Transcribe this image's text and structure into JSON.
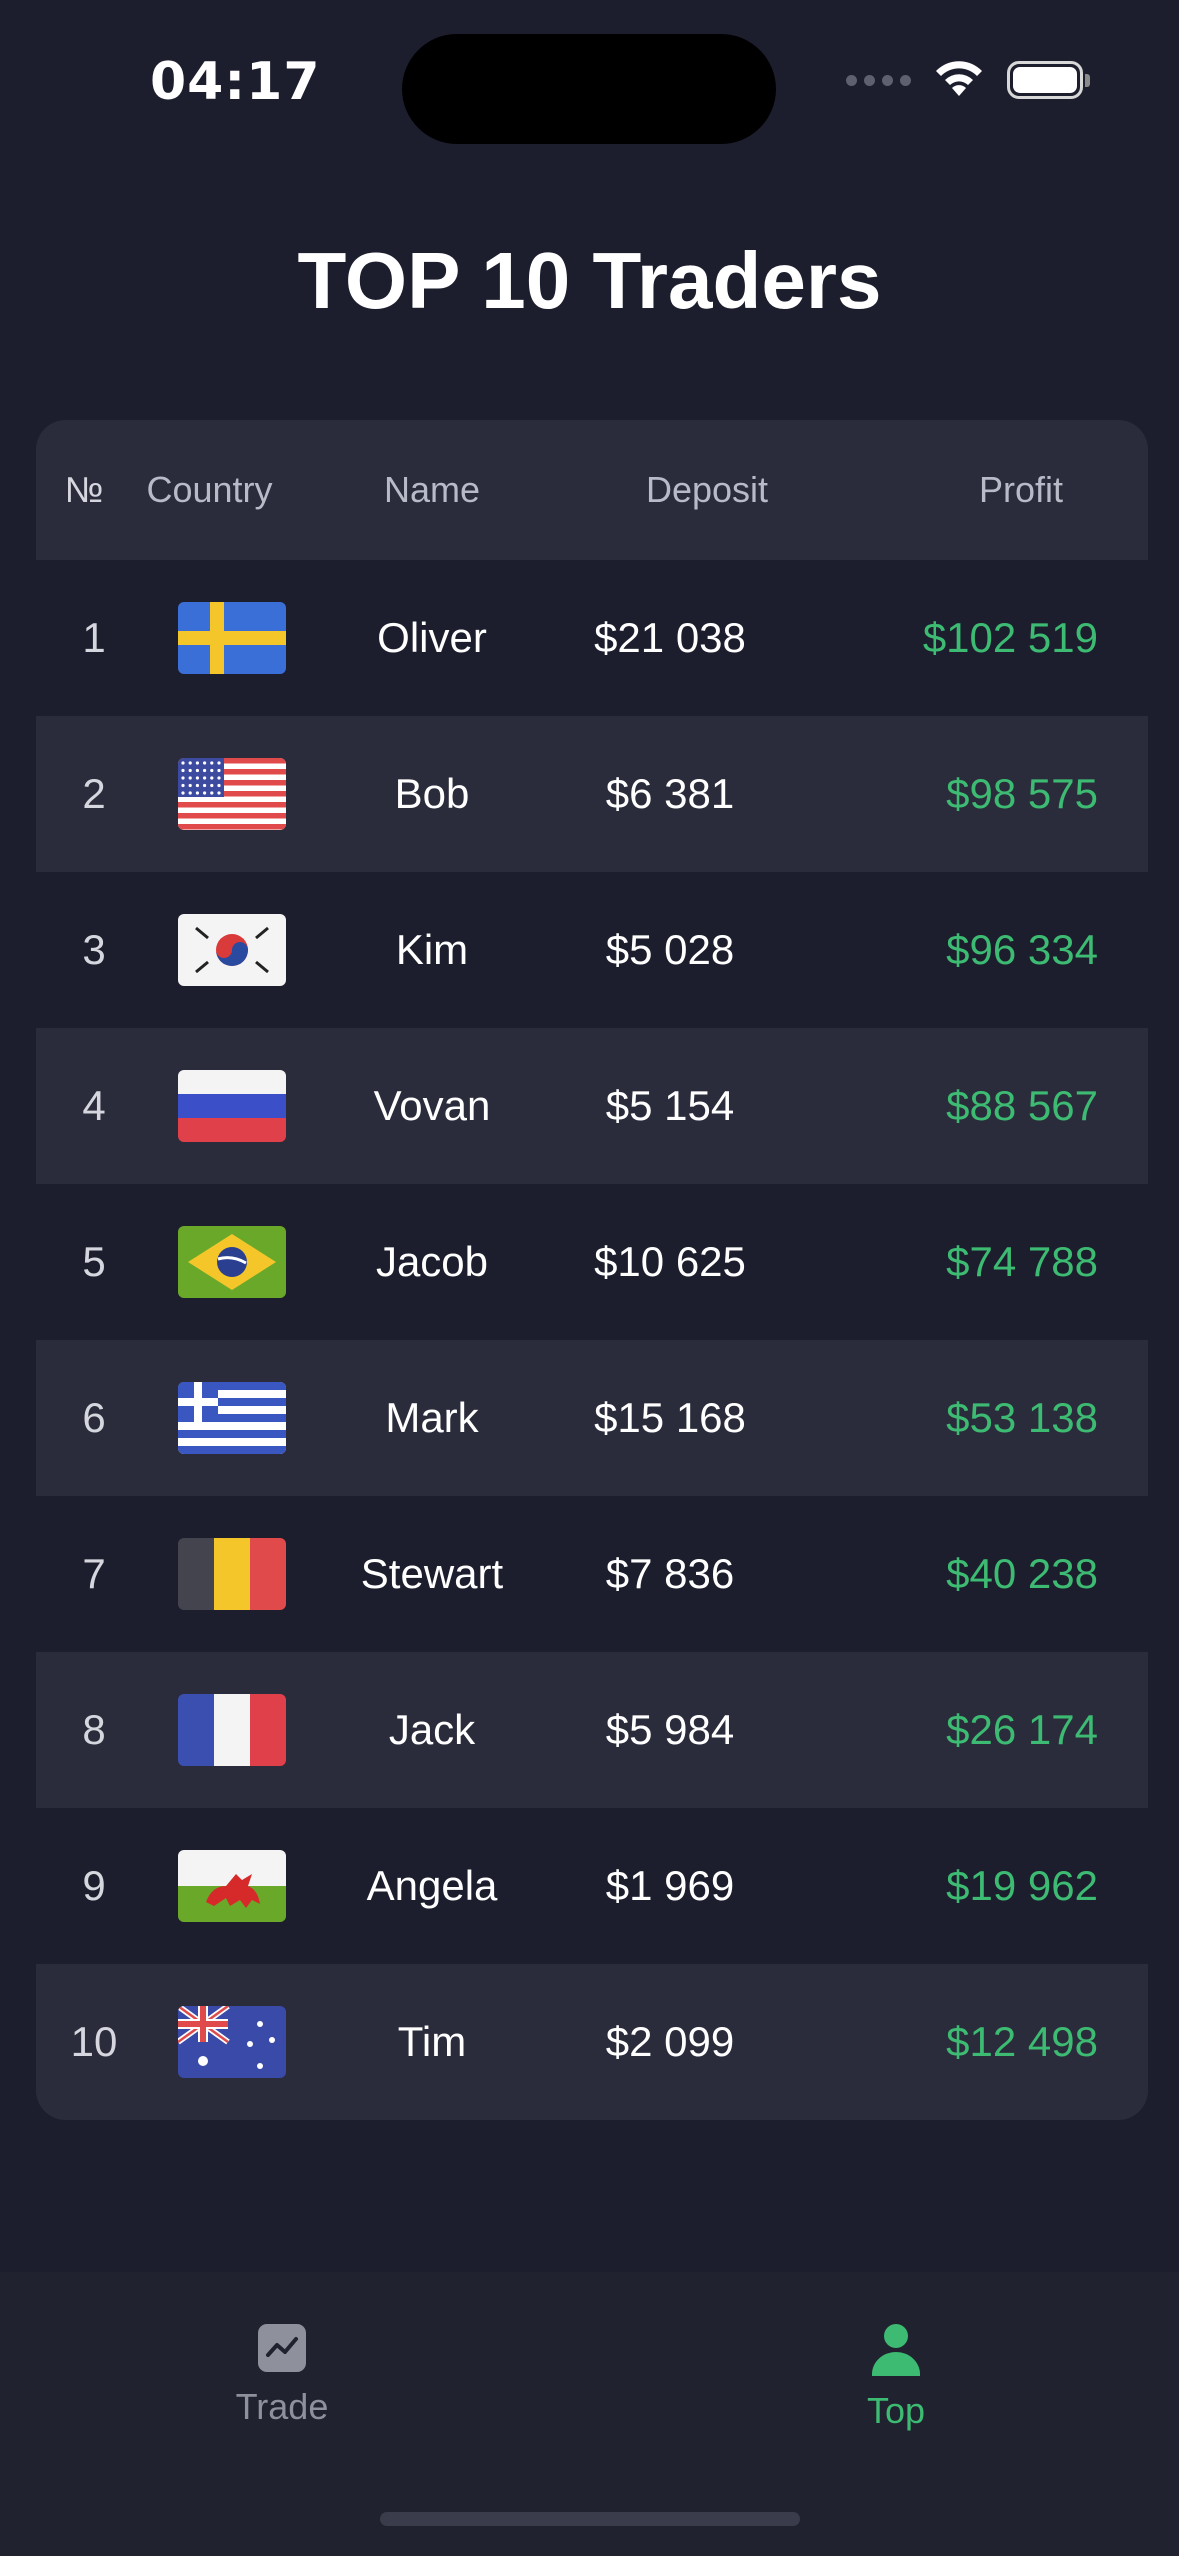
{
  "status_bar": {
    "time": "04:17"
  },
  "title": "TOP 10 Traders",
  "table": {
    "headers": {
      "num": "№",
      "country": "Country",
      "name": "Name",
      "deposit": "Deposit",
      "profit": "Profit"
    },
    "rows": [
      {
        "num": "1",
        "flag": "sweden",
        "name": "Oliver",
        "deposit": "$21 038",
        "profit": "$102 519"
      },
      {
        "num": "2",
        "flag": "usa",
        "name": "Bob",
        "deposit": "$6 381",
        "profit": "$98 575"
      },
      {
        "num": "3",
        "flag": "south-korea",
        "name": "Kim",
        "deposit": "$5 028",
        "profit": "$96 334"
      },
      {
        "num": "4",
        "flag": "russia",
        "name": "Vovan",
        "deposit": "$5 154",
        "profit": "$88 567"
      },
      {
        "num": "5",
        "flag": "brazil",
        "name": "Jacob",
        "deposit": "$10 625",
        "profit": "$74 788"
      },
      {
        "num": "6",
        "flag": "greece",
        "name": "Mark",
        "deposit": "$15 168",
        "profit": "$53 138"
      },
      {
        "num": "7",
        "flag": "belgium",
        "name": "Stewart",
        "deposit": "$7 836",
        "profit": "$40 238"
      },
      {
        "num": "8",
        "flag": "france",
        "name": "Jack",
        "deposit": "$5 984",
        "profit": "$26 174"
      },
      {
        "num": "9",
        "flag": "wales",
        "name": "Angela",
        "deposit": "$1 969",
        "profit": "$19 962"
      },
      {
        "num": "10",
        "flag": "australia",
        "name": "Tim",
        "deposit": "$2 099",
        "profit": "$12 498"
      }
    ]
  },
  "tabs": [
    {
      "label": "Trade",
      "icon": "chart-icon",
      "active": false
    },
    {
      "label": "Top",
      "icon": "person-icon",
      "active": true
    }
  ],
  "colors": {
    "background": "#1c1e2d",
    "card": "#2a2c3b",
    "profit": "#3dbb72",
    "accent": "#3dbb72"
  }
}
